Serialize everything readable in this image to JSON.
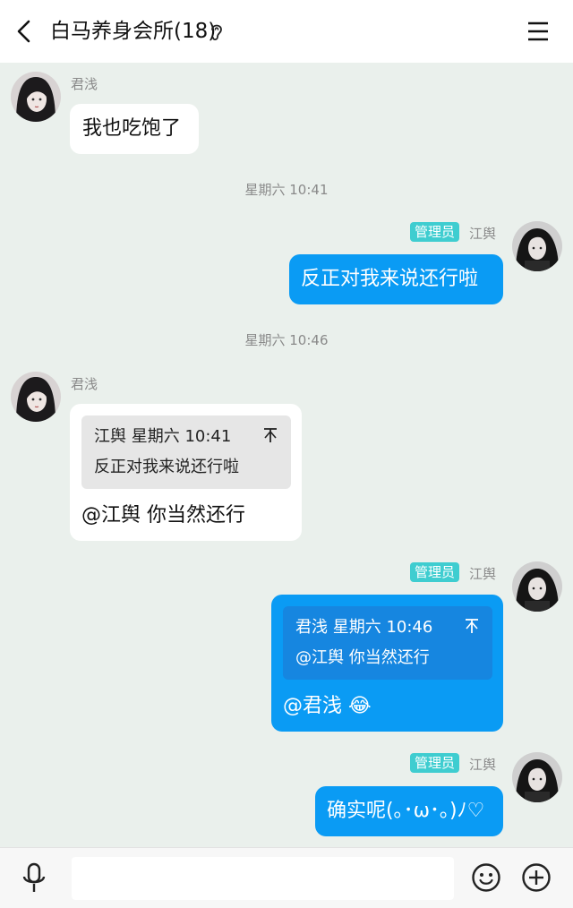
{
  "header": {
    "title": "白马养身会所(18)",
    "back_icon": "chevron-left-icon",
    "ear_icon": "ear-icon",
    "menu_icon": "hamburger-menu-icon"
  },
  "messages": {
    "m1": {
      "sender": "君浅",
      "text": "我也吃饱了"
    },
    "t1": "星期六 10:41",
    "m2": {
      "badge": "管理员",
      "sender": "江舆",
      "text": "反正对我来说还行啦"
    },
    "t2": "星期六 10:46",
    "m3": {
      "sender": "君浅",
      "quote_head": "江舆 星期六 10:41",
      "quote_body": "反正对我来说还行啦",
      "text": "@江舆 你当然还行"
    },
    "m4": {
      "badge": "管理员",
      "sender": "江舆",
      "quote_head": "君浅 星期六 10:46",
      "quote_body": "@江舆 你当然还行",
      "text": "@君浅",
      "emoji": "😂"
    },
    "m5": {
      "badge": "管理员",
      "sender": "江舆",
      "text": "确实呢(｡･ω･｡)ﾉ♡"
    }
  },
  "input_bar": {
    "placeholder": "",
    "value": "",
    "mic_icon": "microphone-icon",
    "emoji_icon": "smiley-icon",
    "plus_icon": "plus-circle-icon"
  },
  "colors": {
    "background": "#eaf0ec",
    "outgoing_bubble": "#0a9bf4",
    "incoming_bubble": "#ffffff",
    "admin_badge": "#3fcdd0"
  }
}
